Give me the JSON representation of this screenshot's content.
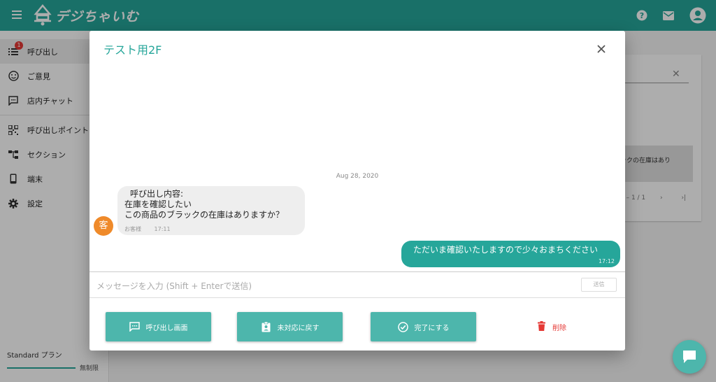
{
  "app": {
    "brand": "デジちゃいむ"
  },
  "sidebar": {
    "items": [
      {
        "label": "呼び出し",
        "icon": "list-icon",
        "badge": "1",
        "active": true
      },
      {
        "label": "ご意見",
        "icon": "feedback-icon"
      },
      {
        "label": "店内チャット",
        "icon": "chat-icon"
      },
      {
        "label": "呼び出しポイント",
        "icon": "qr-code-icon"
      },
      {
        "label": "セクション",
        "icon": "section-tree-icon"
      },
      {
        "label": "端末",
        "icon": "phone-icon"
      },
      {
        "label": "設定",
        "icon": "gear-icon"
      }
    ],
    "plan": {
      "name": "Standard プラン",
      "limit": "無制限"
    }
  },
  "background": {
    "row_text": "ックの在庫はあり",
    "pager": "1 – 1 / 1"
  },
  "dialog": {
    "title": "テスト用2F",
    "date": "Aug 28, 2020",
    "customer_message": {
      "avatar": "客",
      "lines": [
        "呼び出し内容:",
        "在庫を確認したい",
        "この商品のブラックの在庫はありますか？"
      ],
      "sender": "お客様",
      "time": "17:11"
    },
    "staff_message": {
      "text": "ただいま確認いたしますので少々おまちください",
      "time": "17:12"
    },
    "input": {
      "placeholder": "メッセージを入力 (Shift + Enterで送信)",
      "send_label": "送信"
    },
    "actions": {
      "call_screen": "呼び出し画面",
      "revert": "未対応に戻す",
      "complete": "完了にする",
      "delete": "削除"
    }
  },
  "colors": {
    "primary": "#26a69a",
    "button": "#4db6ac",
    "danger": "#e53935",
    "avatar": "#ef8a2a"
  }
}
